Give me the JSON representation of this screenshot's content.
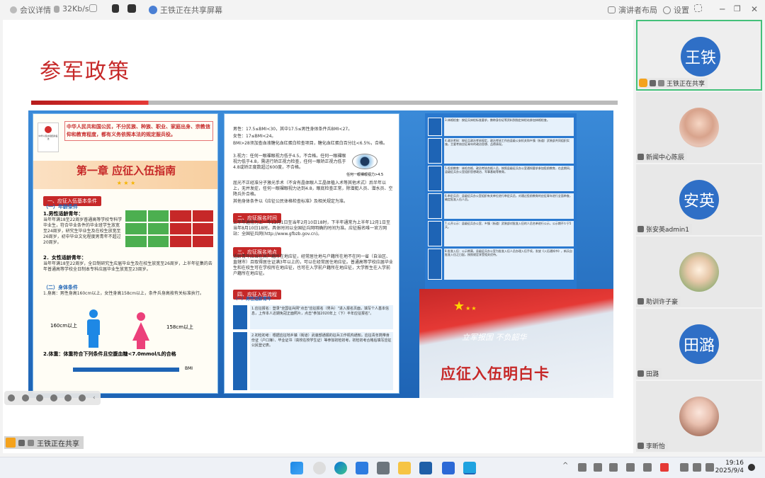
{
  "topbar": {
    "meeting_details": "会议详情",
    "bitrate": "32Kb/s",
    "sharing_title": "王铁正在共享屏幕",
    "speaker_layout": "演讲者布局",
    "settings": "设置"
  },
  "slide": {
    "title": "参军政策",
    "brochure": {
      "intro_text": "中华人民共和国公民，不分民族、种族、职业、家庭出身、宗教信仰和教育程度，都有义务依照本法的规定服兵役。",
      "book_cover_text": "中华人民共和国兵役法",
      "chapter_title": "第一章  应征入伍指南",
      "section1": "一、应征入伍基本条件",
      "sub1": "（一）年龄条件",
      "age1_title": "1.男性适龄青年：",
      "age1_text": "当年年满18至22周岁普通高等学校专科学毕业生，符合毕业条件的毕业班学生放宽至24周岁，研究生毕业生及在校生放宽至26周岁，初中毕业文化程度男青年不超过20周岁。",
      "age2_title": "2．女性适龄青年：",
      "age2_text": "当年年满18至22周岁，全日制研究生应届毕业生及在校生放宽至26周岁，上半年征集的去年普通高等学校全日制本专科应届毕业生放宽至23周岁。",
      "sub2": "（二）身体条件",
      "height_text": "1.身高：男性身高160cm以上，女性身高158cm以上，条件兵身高按有关标准执行。",
      "male_height": "160cm以上",
      "female_height": "158cm以上",
      "weight_text": "2.体重：体重符合下列条件且空腹血糖<7.0mmol/L的合格",
      "bmi_label": "BMI",
      "mid_text1": "男性：17.5≤BMI<30，其中17.5≤男性身体条件兵BMI<27。",
      "mid_text2": "女性：17≤BMI<24。",
      "mid_text3": "BMI>28须加查血液糖化血红蛋白检查项目，糖化血红蛋白百分比<6.5%，合格。",
      "vision_text": "3.视力：任何一眼裸眼视力低于4.5，不合格。任何一眼裸眼视力低于4.8，需进行矫正视力检查，任何一眼矫正视力低于4.8或矫正度数超过600度，不合格。",
      "vision_caption": "任何一眼裸眼视力>4.5",
      "mid_text4": "屈光不正经准分子激光手术（不含有晶体眼人工晶体植入术等其他术式）后半年以上，无并发症，任何一眼裸眼视力达到4.8，眼底检查正常，除潜艇人员、潜水员、空降兵外合格。",
      "mid_text5": "其他身体条件以《应征公民体格检查标准》及相关规定为准。",
      "section2": "二、应征报名时间",
      "time_text": "上半年通常为上一年12月1日至当年2月10日18时，下半年通常为上半年12月1日至当年8月10日18时。具体时间以全国征兵网明确的时间为准。应征报名唯一官方网站：全国征兵网(http://www.gfbzb.gov.cn)。",
      "section3": "三、应征报名地点",
      "place_text": "适龄青年应当在其户籍所在地应征，经常居住地与户籍所在地不在同一省（自治区、直辖市）且取得居住证满3年以上的，可以在经常居住地应征。普通高等学校应届毕业生和在校生可在学校所在地应征，也可在入学前户籍所在地应征，大学新生在入学前户籍所在地应征。",
      "section4": "四、应征入伍流程",
      "flow_sub": "（一）男性适龄青年",
      "flow_step1": "1.应征报名：登录\"全国征兵网\"点击\"应征报名（男兵）\"进入报名页面，填写个人基本信息，上传本人近期免冠正面照片，点击\"参加2020年上（下）半年应征报名\"。",
      "flow_step2": "2.初检初考：根据应征地乡镇（街道）武装部通报的征兵工作机构通知，应征青年携带身份证（户口簿）、毕业证书（高校在校学生证）等参加初检初考，初检初考合格后填写应征公民登记表。",
      "right_step3": "3.体格检查：按征兵体检标准要求，携带身份证等资料到指定体检站参加体格检查。",
      "right_step4": "4.政治考核：按征兵政治考核规定，政治考核工作由县级公安机关和乡镇（街道）武装部共同组织实施，主要考核应征青年的政治思想、品德表现。",
      "right_step5": "5.役前教育：体检合格、政治考核合格人员，按照县级征兵办公室通知要求参加役前教育，在此期间，县级征兵办公室组织思想政治、军事基础等教育。",
      "right_step6": "6.审定兵员：县级征兵办公室组织有关单位进行审定兵员，对通过役前教育的应征青年进行全面审查，确定批准入伍人员。",
      "right_step7": "7.公开公示：县级征兵办公室、乡镇（街道）武装部对批准入伍的人员名单进行公示，公示期不少于5天。",
      "right_step8": "8.批准入伍：公示期满，县级征兵办公室为批准入伍人员办理入伍手续，发放《入伍通知书》，新兵自批准入伍之日起，按照规定享受相关优待。",
      "slogan": "立军报国   不负韶华",
      "white_card": "应征入伍明白卡"
    }
  },
  "participants": [
    {
      "name": "王铁正在共享",
      "avatar_text": "王铁",
      "color": "#2f6fc6",
      "active": true
    },
    {
      "name": "新闻中心陈辰",
      "avatar_text": "",
      "color": "",
      "active": false
    },
    {
      "name": "张安英admin1",
      "avatar_text": "安英",
      "color": "#2f6fc6",
      "active": false
    },
    {
      "name": "助训许子豪",
      "avatar_text": "",
      "color": "",
      "active": false
    },
    {
      "name": "田潞",
      "avatar_text": "田潞",
      "color": "#2f6fc6",
      "active": false
    },
    {
      "name": "李昕怡",
      "avatar_text": "",
      "color": "",
      "active": false
    }
  ],
  "share_tag": "王铁正在共享",
  "taskbar": {
    "time": "19:16",
    "date": "2025/9/4"
  },
  "colors": {
    "accent_red": "#c62828",
    "avatar_blue": "#2f6fc6",
    "active_border": "#43c07a"
  }
}
